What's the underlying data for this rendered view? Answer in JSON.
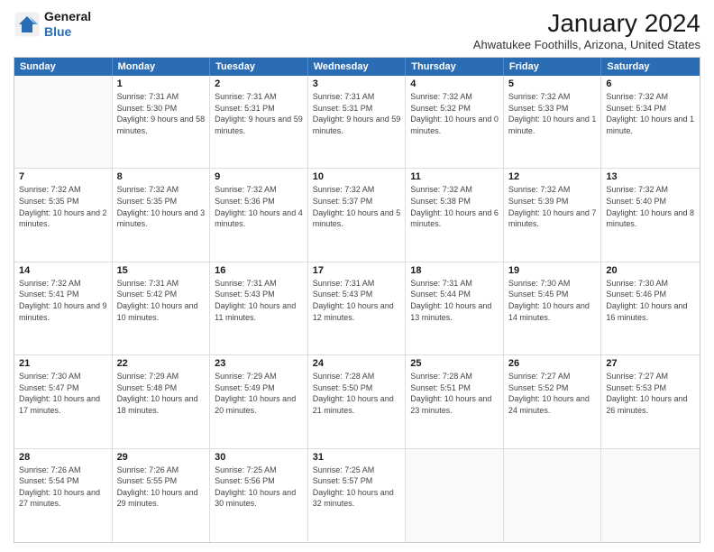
{
  "header": {
    "logo": {
      "general": "General",
      "blue": "Blue"
    },
    "title": "January 2024",
    "location": "Ahwatukee Foothills, Arizona, United States"
  },
  "days_of_week": [
    "Sunday",
    "Monday",
    "Tuesday",
    "Wednesday",
    "Thursday",
    "Friday",
    "Saturday"
  ],
  "weeks": [
    [
      {
        "day": "",
        "sunrise": "",
        "sunset": "",
        "daylight": ""
      },
      {
        "day": "1",
        "sunrise": "Sunrise: 7:31 AM",
        "sunset": "Sunset: 5:30 PM",
        "daylight": "Daylight: 9 hours and 58 minutes."
      },
      {
        "day": "2",
        "sunrise": "Sunrise: 7:31 AM",
        "sunset": "Sunset: 5:31 PM",
        "daylight": "Daylight: 9 hours and 59 minutes."
      },
      {
        "day": "3",
        "sunrise": "Sunrise: 7:31 AM",
        "sunset": "Sunset: 5:31 PM",
        "daylight": "Daylight: 9 hours and 59 minutes."
      },
      {
        "day": "4",
        "sunrise": "Sunrise: 7:32 AM",
        "sunset": "Sunset: 5:32 PM",
        "daylight": "Daylight: 10 hours and 0 minutes."
      },
      {
        "day": "5",
        "sunrise": "Sunrise: 7:32 AM",
        "sunset": "Sunset: 5:33 PM",
        "daylight": "Daylight: 10 hours and 1 minute."
      },
      {
        "day": "6",
        "sunrise": "Sunrise: 7:32 AM",
        "sunset": "Sunset: 5:34 PM",
        "daylight": "Daylight: 10 hours and 1 minute."
      }
    ],
    [
      {
        "day": "7",
        "sunrise": "Sunrise: 7:32 AM",
        "sunset": "Sunset: 5:35 PM",
        "daylight": "Daylight: 10 hours and 2 minutes."
      },
      {
        "day": "8",
        "sunrise": "Sunrise: 7:32 AM",
        "sunset": "Sunset: 5:35 PM",
        "daylight": "Daylight: 10 hours and 3 minutes."
      },
      {
        "day": "9",
        "sunrise": "Sunrise: 7:32 AM",
        "sunset": "Sunset: 5:36 PM",
        "daylight": "Daylight: 10 hours and 4 minutes."
      },
      {
        "day": "10",
        "sunrise": "Sunrise: 7:32 AM",
        "sunset": "Sunset: 5:37 PM",
        "daylight": "Daylight: 10 hours and 5 minutes."
      },
      {
        "day": "11",
        "sunrise": "Sunrise: 7:32 AM",
        "sunset": "Sunset: 5:38 PM",
        "daylight": "Daylight: 10 hours and 6 minutes."
      },
      {
        "day": "12",
        "sunrise": "Sunrise: 7:32 AM",
        "sunset": "Sunset: 5:39 PM",
        "daylight": "Daylight: 10 hours and 7 minutes."
      },
      {
        "day": "13",
        "sunrise": "Sunrise: 7:32 AM",
        "sunset": "Sunset: 5:40 PM",
        "daylight": "Daylight: 10 hours and 8 minutes."
      }
    ],
    [
      {
        "day": "14",
        "sunrise": "Sunrise: 7:32 AM",
        "sunset": "Sunset: 5:41 PM",
        "daylight": "Daylight: 10 hours and 9 minutes."
      },
      {
        "day": "15",
        "sunrise": "Sunrise: 7:31 AM",
        "sunset": "Sunset: 5:42 PM",
        "daylight": "Daylight: 10 hours and 10 minutes."
      },
      {
        "day": "16",
        "sunrise": "Sunrise: 7:31 AM",
        "sunset": "Sunset: 5:43 PM",
        "daylight": "Daylight: 10 hours and 11 minutes."
      },
      {
        "day": "17",
        "sunrise": "Sunrise: 7:31 AM",
        "sunset": "Sunset: 5:43 PM",
        "daylight": "Daylight: 10 hours and 12 minutes."
      },
      {
        "day": "18",
        "sunrise": "Sunrise: 7:31 AM",
        "sunset": "Sunset: 5:44 PM",
        "daylight": "Daylight: 10 hours and 13 minutes."
      },
      {
        "day": "19",
        "sunrise": "Sunrise: 7:30 AM",
        "sunset": "Sunset: 5:45 PM",
        "daylight": "Daylight: 10 hours and 14 minutes."
      },
      {
        "day": "20",
        "sunrise": "Sunrise: 7:30 AM",
        "sunset": "Sunset: 5:46 PM",
        "daylight": "Daylight: 10 hours and 16 minutes."
      }
    ],
    [
      {
        "day": "21",
        "sunrise": "Sunrise: 7:30 AM",
        "sunset": "Sunset: 5:47 PM",
        "daylight": "Daylight: 10 hours and 17 minutes."
      },
      {
        "day": "22",
        "sunrise": "Sunrise: 7:29 AM",
        "sunset": "Sunset: 5:48 PM",
        "daylight": "Daylight: 10 hours and 18 minutes."
      },
      {
        "day": "23",
        "sunrise": "Sunrise: 7:29 AM",
        "sunset": "Sunset: 5:49 PM",
        "daylight": "Daylight: 10 hours and 20 minutes."
      },
      {
        "day": "24",
        "sunrise": "Sunrise: 7:28 AM",
        "sunset": "Sunset: 5:50 PM",
        "daylight": "Daylight: 10 hours and 21 minutes."
      },
      {
        "day": "25",
        "sunrise": "Sunrise: 7:28 AM",
        "sunset": "Sunset: 5:51 PM",
        "daylight": "Daylight: 10 hours and 23 minutes."
      },
      {
        "day": "26",
        "sunrise": "Sunrise: 7:27 AM",
        "sunset": "Sunset: 5:52 PM",
        "daylight": "Daylight: 10 hours and 24 minutes."
      },
      {
        "day": "27",
        "sunrise": "Sunrise: 7:27 AM",
        "sunset": "Sunset: 5:53 PM",
        "daylight": "Daylight: 10 hours and 26 minutes."
      }
    ],
    [
      {
        "day": "28",
        "sunrise": "Sunrise: 7:26 AM",
        "sunset": "Sunset: 5:54 PM",
        "daylight": "Daylight: 10 hours and 27 minutes."
      },
      {
        "day": "29",
        "sunrise": "Sunrise: 7:26 AM",
        "sunset": "Sunset: 5:55 PM",
        "daylight": "Daylight: 10 hours and 29 minutes."
      },
      {
        "day": "30",
        "sunrise": "Sunrise: 7:25 AM",
        "sunset": "Sunset: 5:56 PM",
        "daylight": "Daylight: 10 hours and 30 minutes."
      },
      {
        "day": "31",
        "sunrise": "Sunrise: 7:25 AM",
        "sunset": "Sunset: 5:57 PM",
        "daylight": "Daylight: 10 hours and 32 minutes."
      },
      {
        "day": "",
        "sunrise": "",
        "sunset": "",
        "daylight": ""
      },
      {
        "day": "",
        "sunrise": "",
        "sunset": "",
        "daylight": ""
      },
      {
        "day": "",
        "sunrise": "",
        "sunset": "",
        "daylight": ""
      }
    ]
  ]
}
